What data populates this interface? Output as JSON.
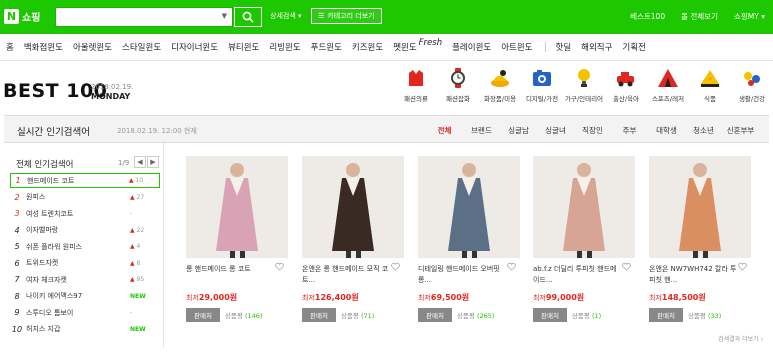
{
  "header": {
    "logo_letter": "N",
    "logo_text": "쇼핑",
    "search_placeholder": "",
    "search_dropdown": "▼",
    "detail_search": "상세검색 ▾",
    "category_button": "카테고리 더보기",
    "links": [
      "베스트100",
      "몰 전체보기",
      "쇼핑MY ▾"
    ]
  },
  "nav": {
    "items": [
      "홈",
      "백화점윈도",
      "아울렛윈도",
      "스타일윈도",
      "디자이너윈도",
      "뷰티윈도",
      "리빙윈도",
      "푸드윈도",
      "키즈윈도",
      "펫윈도"
    ],
    "fresh": "Fresh",
    "items2": [
      "플레이윈도",
      "아트윈도"
    ],
    "items3": [
      "핫딜",
      "해외직구",
      "기획전"
    ]
  },
  "hero": {
    "title": "BEST 100",
    "date": "2018.02.19.",
    "day": "MONDAY"
  },
  "categories": [
    {
      "label": "패션의류",
      "icon": "clothing-icon",
      "color": "#e2261e"
    },
    {
      "label": "패션잡화",
      "icon": "watch-icon",
      "color": "#444"
    },
    {
      "label": "화장품/미용",
      "icon": "cosmetics-icon",
      "color": "#f4a800"
    },
    {
      "label": "디지털/가전",
      "icon": "camera-icon",
      "color": "#2563c9"
    },
    {
      "label": "가구/인테리어",
      "icon": "lamp-icon",
      "color": "#f6c200"
    },
    {
      "label": "출산/육아",
      "icon": "toy-car-icon",
      "color": "#e2261e"
    },
    {
      "label": "스포츠/레저",
      "icon": "tent-icon",
      "color": "#e2261e"
    },
    {
      "label": "식품",
      "icon": "cheese-icon",
      "color": "#f6c200"
    },
    {
      "label": "생활/건강",
      "icon": "ornament-icon",
      "color": "#2563c9"
    }
  ],
  "panel": {
    "title": "실시간 인기검색어",
    "time": "2018.02.19. 12:00 현재",
    "tabs": [
      "전체",
      "브랜드",
      "싱글남",
      "싱글녀",
      "직장인",
      "주부",
      "대학생",
      "청소년",
      "신혼부부"
    ],
    "active_tab": "전체"
  },
  "ranking": {
    "title": "전체 인기검색어",
    "page": "1/9",
    "prev": "◀",
    "next": "▶",
    "items": [
      {
        "num": "1",
        "name": "핸드메이드 코트",
        "trend": "▲",
        "val": "10"
      },
      {
        "num": "2",
        "name": "원피스",
        "trend": "▲",
        "val": "27"
      },
      {
        "num": "3",
        "name": "여성 트렌치코트",
        "trend": "",
        "val": "-"
      },
      {
        "num": "4",
        "name": "이자벨마랑",
        "trend": "▲",
        "val": "22"
      },
      {
        "num": "5",
        "name": "쉬폰 플라워 원피스",
        "trend": "▲",
        "val": "4"
      },
      {
        "num": "6",
        "name": "트위드자켓",
        "trend": "▲",
        "val": "8"
      },
      {
        "num": "7",
        "name": "여자 체크자켓",
        "trend": "▲",
        "val": "95"
      },
      {
        "num": "8",
        "name": "나이키 에어맥스97",
        "trend": "",
        "val": "NEW"
      },
      {
        "num": "9",
        "name": "스투디오 톰보이",
        "trend": "",
        "val": "-"
      },
      {
        "num": "10",
        "name": "허지스 지갑",
        "trend": "",
        "val": "NEW"
      }
    ]
  },
  "products": [
    {
      "name": "롱 핸드메이드 롱 코트",
      "price": "29,000원",
      "seller": "판매처",
      "reviews": "상품평",
      "count": "(146)",
      "coat": "#d9a3b5"
    },
    {
      "name": "온앤온 롱 핸드메이드 모직 코트...",
      "price": "126,400원",
      "seller": "판매처",
      "reviews": "상품평",
      "count": "(71)",
      "coat": "#3a2a24"
    },
    {
      "name": "디테일링 핸드메이드 오버핏 롱...",
      "price": "69,500원",
      "seller": "판매처",
      "reviews": "상품평",
      "count": "(265)",
      "coat": "#5b6f86"
    },
    {
      "name": "ab.f.z 더딜리 투피칫 핸드메이드...",
      "price": "99,000원",
      "seller": "판매처",
      "reviews": "상품평",
      "count": "(1)",
      "coat": "#d7a593"
    },
    {
      "name": "온앤온 NW7WH742 칼라 투피칫 핸...",
      "price": "148,500원",
      "seller": "판매처",
      "reviews": "상품평",
      "count": "(33)",
      "coat": "#d98f62"
    }
  ],
  "price_prefix": "최저",
  "more": "검색결과 더보기 ›"
}
